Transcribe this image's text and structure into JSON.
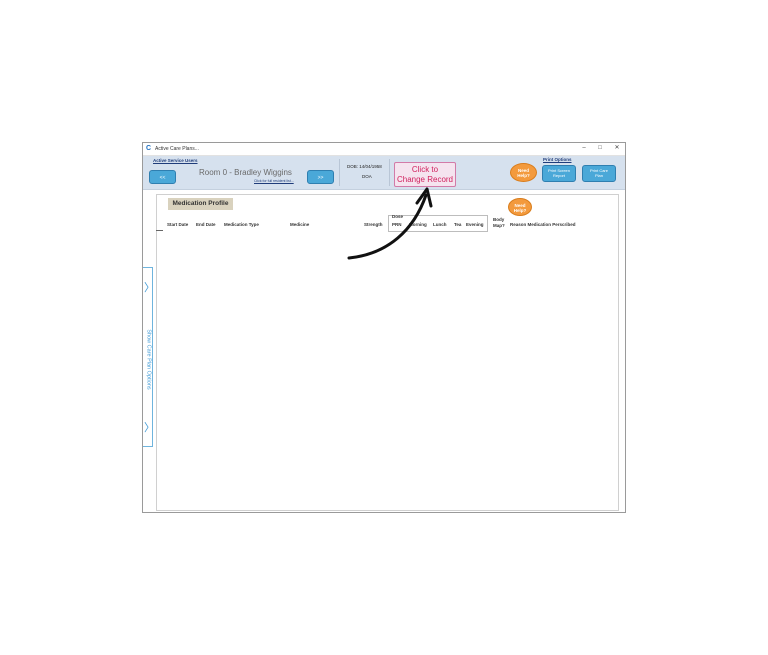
{
  "window": {
    "title": "Active Care Plans...",
    "app_icon": "C",
    "controls": {
      "minimize": "–",
      "maximize": "□",
      "close": "✕"
    }
  },
  "header": {
    "active_service_users_label": "Active Service Users",
    "prev_button": "<<",
    "next_button": ">>",
    "resident_name": "Room 0 - Bradley Wiggins",
    "resident_link": "Click for full resident list...",
    "dob": "DOB: 14/04/1958",
    "doa": "DOA",
    "change_record_line1": "Click to",
    "change_record_line2": "Change Record",
    "need_help_line1": "Need",
    "need_help_line2": "Help?",
    "print_options_label": "Print Options",
    "print_screen_report_line1": "Print Screen",
    "print_screen_report_line2": "Report",
    "print_care_plan_line1": "Print Care",
    "print_care_plan_line2": "Plan"
  },
  "side_panel": {
    "label": "Show Care Plan Options",
    "chevron": "〉"
  },
  "medication_profile": {
    "title": "Medication Profile",
    "need_help_line1": "Need",
    "need_help_line2": "Help?",
    "columns": {
      "start_date": "Start Date",
      "end_date": "End Date",
      "medication_type": "Medication Type",
      "medicine": "Medicine",
      "strength": "Strength",
      "dose": "Dose",
      "prn": "PRN",
      "morning": "Morning",
      "lunch": "Lunch",
      "tea": "Tea",
      "evening": "Evening",
      "body_map_line1": "Body",
      "body_map_line2": "Map?",
      "reason": "Reason Medication Perscribed"
    }
  },
  "colors": {
    "header_bg": "#d6e1ee",
    "nav_button": "#4aa8d8",
    "change_record_text": "#d0215e",
    "help_bubble": "#f39a3d",
    "title_label_bg": "#d9d2be"
  },
  "icons": {
    "app": "app-logo-icon",
    "side_chevron": "chevron-right-icon",
    "annotation": "curved-arrow-icon"
  }
}
